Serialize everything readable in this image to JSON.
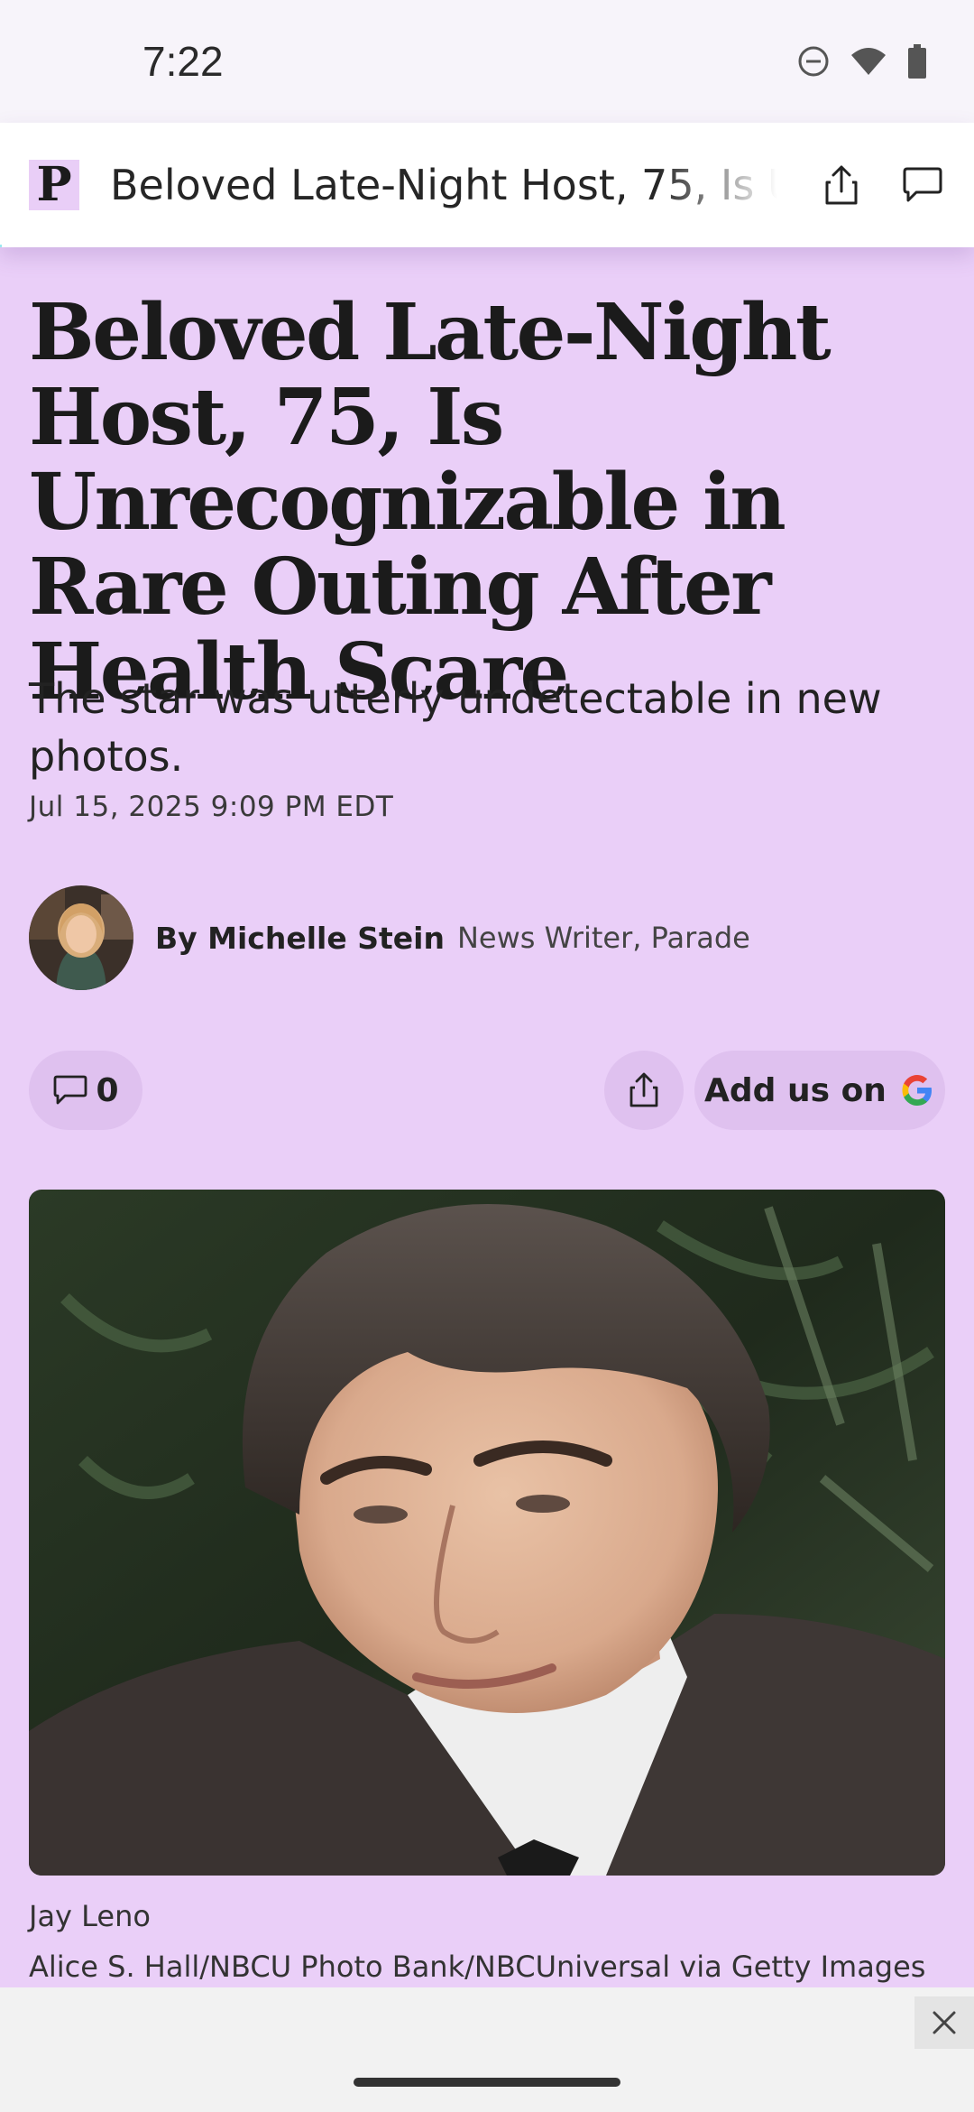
{
  "status_bar": {
    "time": "7:22",
    "icons": [
      "do-not-disturb-icon",
      "wifi-icon",
      "battery-icon"
    ]
  },
  "header": {
    "logo_letter": "P",
    "title": "Beloved Late-Night Host, 75, Is Unrecognizable in Rare Outing After Health Scare",
    "actions": [
      "share-icon",
      "comment-icon"
    ]
  },
  "article": {
    "headline": "Beloved Late-Night Host, 75, Is Unrecognizable in Rare Outing After Health Scare",
    "subhead": "The star was utterly undetectable in new photos.",
    "date": "Jul 15, 2025 9:09 PM EDT",
    "author": {
      "name": "By Michelle Stein",
      "role": "News Writer, Parade"
    },
    "comment_count": "0",
    "google_button_label": "Add us on",
    "image_caption": "Jay Leno",
    "image_credit": "Alice S. Hall/NBCU Photo Bank/NBCUniversal via Getty Images"
  },
  "colors": {
    "background": "#eacff8",
    "pill": "#dfc1ef",
    "text": "#1b1b1b"
  }
}
